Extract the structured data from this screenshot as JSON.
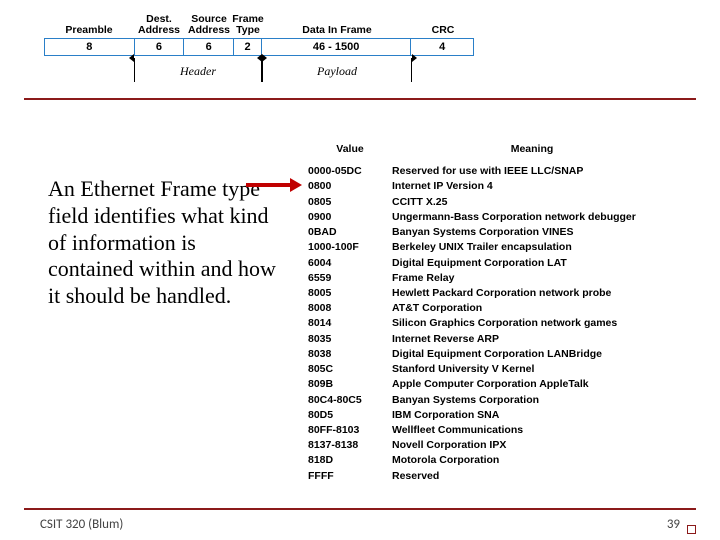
{
  "frame": {
    "headers": {
      "preamble": "Preamble",
      "dest": "Dest.\nAddress",
      "src": "Source\nAddress",
      "type": "Frame\nType",
      "data": "Data In Frame",
      "crc": "CRC"
    },
    "values": {
      "preamble": "8",
      "dest": "6",
      "src": "6",
      "type": "2",
      "data": "46 - 1500",
      "crc": "4"
    },
    "bracket_header": "Header",
    "bracket_payload": "Payload"
  },
  "body_text": "An Ethernet Frame type field identifies what kind of information is contained within and how it should be handled.",
  "type_table": {
    "head_value": "Value",
    "head_meaning": "Meaning",
    "rows": [
      {
        "v": "0000-05DC",
        "m": "Reserved for use with IEEE LLC/SNAP"
      },
      {
        "v": "0800",
        "m": "Internet IP Version 4"
      },
      {
        "v": "0805",
        "m": "CCITT X.25"
      },
      {
        "v": "0900",
        "m": "Ungermann-Bass Corporation network debugger"
      },
      {
        "v": "0BAD",
        "m": "Banyan Systems Corporation VINES"
      },
      {
        "v": "1000-100F",
        "m": "Berkeley UNIX Trailer encapsulation"
      },
      {
        "v": "6004",
        "m": "Digital Equipment Corporation LAT"
      },
      {
        "v": "6559",
        "m": "Frame Relay"
      },
      {
        "v": "8005",
        "m": "Hewlett Packard Corporation network probe"
      },
      {
        "v": "8008",
        "m": "AT&T Corporation"
      },
      {
        "v": "8014",
        "m": "Silicon Graphics Corporation network games"
      },
      {
        "v": "8035",
        "m": "Internet Reverse ARP"
      },
      {
        "v": "8038",
        "m": "Digital Equipment Corporation LANBridge"
      },
      {
        "v": "805C",
        "m": "Stanford University V Kernel"
      },
      {
        "v": "809B",
        "m": "Apple Computer Corporation AppleTalk"
      },
      {
        "v": "80C4-80C5",
        "m": "Banyan Systems Corporation"
      },
      {
        "v": "80D5",
        "m": "IBM Corporation SNA"
      },
      {
        "v": "80FF-8103",
        "m": "Wellfleet Communications"
      },
      {
        "v": "8137-8138",
        "m": "Novell Corporation IPX"
      },
      {
        "v": "818D",
        "m": "Motorola Corporation"
      },
      {
        "v": "FFFF",
        "m": "Reserved"
      }
    ]
  },
  "footer": {
    "left": "CSIT 320 (Blum)",
    "right": "39"
  }
}
